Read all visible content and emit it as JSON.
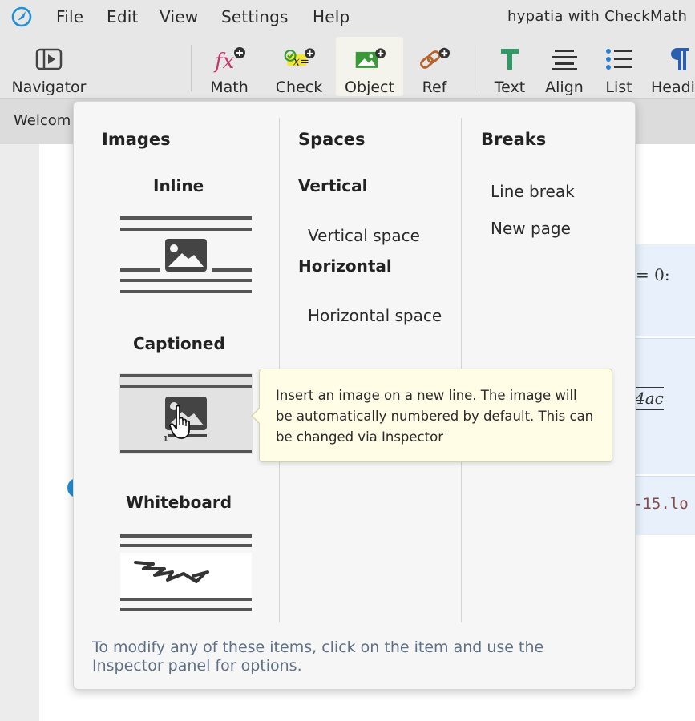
{
  "menubar": {
    "items": [
      "File",
      "Edit",
      "View",
      "Settings",
      "Help"
    ],
    "window_title": "hypatia with CheckMath"
  },
  "toolbar": {
    "navigator": "Navigator",
    "buttons": [
      "Math",
      "Check",
      "Object",
      "Ref",
      "Text",
      "Align",
      "List",
      "Headi"
    ],
    "active": "Object"
  },
  "tab": {
    "label": "Welcom"
  },
  "document": {
    "fragment_1": "= 0:",
    "fragment_2": "4ac",
    "fragment_3": "-15.lo"
  },
  "popup": {
    "images": {
      "heading": "Images",
      "inline": "Inline",
      "captioned": "Captioned",
      "whiteboard": "Whiteboard"
    },
    "spaces": {
      "heading": "Spaces",
      "vertical_heading": "Vertical",
      "vertical_item": "Vertical space",
      "horizontal_heading": "Horizontal",
      "horizontal_item": "Horizontal space"
    },
    "breaks": {
      "heading": "Breaks",
      "line_break": "Line break",
      "new_page": "New page"
    },
    "footer": "To modify any of these items, click on the item and use the Inspector panel for options."
  },
  "tooltip": {
    "text": "Insert an image on a new line. The image will be automatically numbered by default. This can be changed via Inspector"
  },
  "colors": {
    "chrome": "#e7e7e7",
    "popup_bg": "#f6f6f6",
    "tooltip_bg": "#fffde6",
    "footer_text": "#5f6f86",
    "doc_block": "#e8f1fb",
    "accent": "#1e90d6"
  }
}
